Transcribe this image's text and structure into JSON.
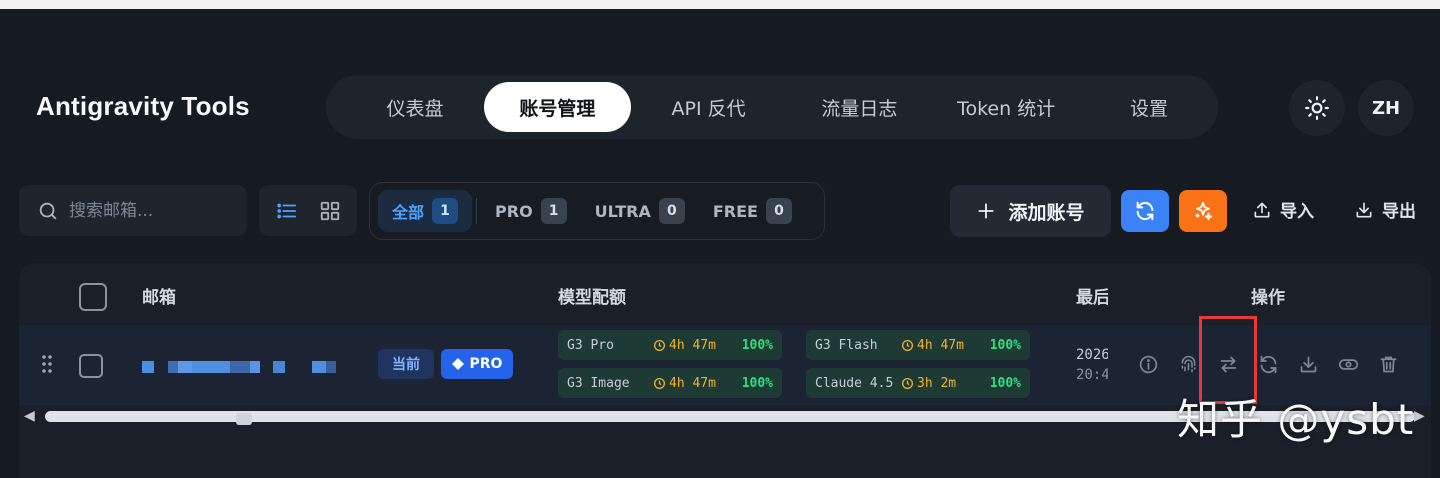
{
  "app": {
    "title": "Antigravity Tools"
  },
  "nav": {
    "tabs": [
      {
        "label": "仪表盘",
        "active": false
      },
      {
        "label": "账号管理",
        "active": true
      },
      {
        "label": "API 反代",
        "active": false
      },
      {
        "label": "流量日志",
        "active": false
      },
      {
        "label": "Token 统计",
        "active": false
      },
      {
        "label": "设置",
        "active": false
      }
    ]
  },
  "header": {
    "theme_icon": "sun-icon",
    "language_label": "ZH"
  },
  "toolbar": {
    "search_placeholder": "搜索邮箱...",
    "view_modes": [
      "list-view-icon",
      "grid-view-icon"
    ],
    "filters": [
      {
        "label": "全部",
        "count": "1",
        "active": true
      },
      {
        "label": "PRO",
        "count": "1",
        "active": false
      },
      {
        "label": "ULTRA",
        "count": "0",
        "active": false
      },
      {
        "label": "FREE",
        "count": "0",
        "active": false
      }
    ],
    "add_label": "添加账号",
    "import_label": "导入",
    "export_label": "导出",
    "refresh_color": "#3b82f6",
    "magic_color": "#f97316"
  },
  "table": {
    "headers": {
      "email": "邮箱",
      "quota": "模型配额",
      "last": "最后",
      "actions": "操作"
    },
    "rows": [
      {
        "badges": {
          "current": "当前",
          "plan": "PRO"
        },
        "quotas": [
          {
            "model": "G3 Pro",
            "reset": "4h 47m",
            "percent": "100%"
          },
          {
            "model": "G3 Flash",
            "reset": "4h 47m",
            "percent": "100%"
          },
          {
            "model": "G3 Image",
            "reset": "4h 47m",
            "percent": "100%"
          },
          {
            "model": "Claude 4.5",
            "reset": "3h 2m",
            "percent": "100%"
          }
        ],
        "last_used": {
          "date": "2026",
          "time": "20:4"
        },
        "actions": [
          "info-icon",
          "fingerprint-icon",
          "switch-icon",
          "refresh-icon",
          "download-icon",
          "eye-icon",
          "trash-icon"
        ]
      }
    ]
  },
  "watermark": "知乎 @ysbt"
}
